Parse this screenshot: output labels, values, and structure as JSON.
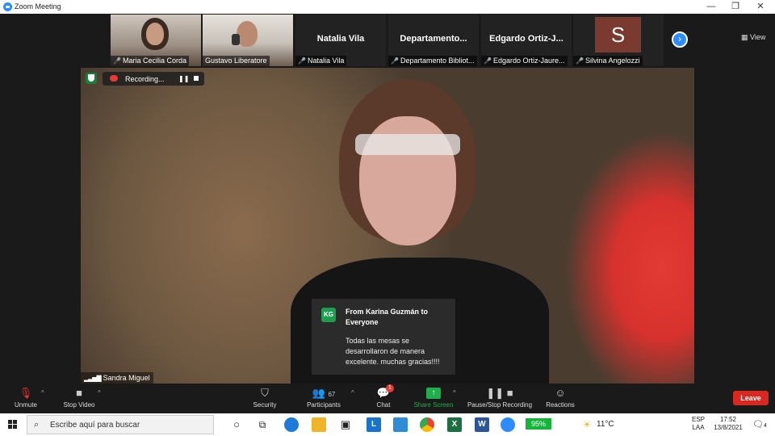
{
  "window": {
    "title": "Zoom Meeting",
    "minimize": "—",
    "restore": "❐",
    "close": "✕"
  },
  "gallery": {
    "tiles": [
      {
        "name": "Maria Cecilia Corda",
        "type": "video"
      },
      {
        "name": "Gustavo Liberatore",
        "type": "video"
      },
      {
        "name": "Natalia Vila",
        "display": "Natalia Vila",
        "type": "name"
      },
      {
        "name": "Departamento Bibliot...",
        "display": "Departamento...",
        "type": "name"
      },
      {
        "name": "Edgardo Ortiz-Jaure...",
        "display": "Edgardo  Ortiz-J...",
        "type": "name"
      },
      {
        "name": "Silvina Angelozzi",
        "initial": "S",
        "type": "avatar"
      }
    ],
    "next_icon": "›",
    "view_label": "View",
    "view_icon": "▦"
  },
  "main": {
    "recording_label": "Recording...",
    "pause_icon": "❚❚",
    "speaker_name": "Sandra Miguel",
    "signal_icon": "▂▃▅▇"
  },
  "chat_popup": {
    "initials": "KG",
    "from": "From Karina Guzmán to Everyone",
    "message": "Todas las mesas se desarrollaron de manera excelente. muchas gracias!!!!"
  },
  "toolbar": {
    "unmute": "Unmute",
    "stop_video": "Stop Video",
    "security": "Security",
    "participants": "Participants",
    "participants_count": "67",
    "chat": "Chat",
    "chat_badge": "1",
    "share_screen": "Share Screen",
    "pause_stop_recording": "Pause/Stop Recording",
    "reactions": "Reactions",
    "leave": "Leave",
    "caret": "^"
  },
  "taskbar": {
    "search_placeholder": "Escribe aquí para buscar",
    "battery": "95%",
    "temperature": "11°C",
    "lang1": "ESP",
    "lang2": "LAA",
    "time": "17:52",
    "date": "13/8/2021",
    "notification_count": "4",
    "cortana_icon": "○",
    "taskview_icon": "⧉",
    "store_icon": "▣",
    "l_app": "L",
    "excel": "X",
    "word": "W"
  },
  "colors": {
    "zoom_blue": "#2D8CFF",
    "leave_red": "#D9281F",
    "share_green": "#1FAE4B"
  }
}
